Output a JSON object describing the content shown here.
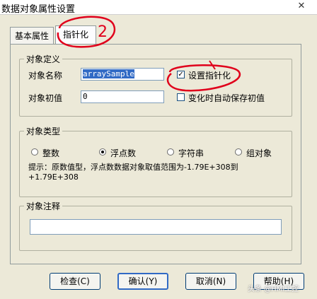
{
  "window": {
    "title": "数据对象属性设置",
    "close_glyph": "✕"
  },
  "tabs": [
    {
      "label": "基本属性"
    },
    {
      "label": "指针化"
    }
  ],
  "object_def": {
    "group_label": "对象定义",
    "name_label": "对象名称",
    "name_value": "arraySample",
    "init_label": "对象初值",
    "init_value": "0",
    "set_pointer_label": "设置指针化",
    "set_pointer_checked": true,
    "auto_save_label": "变化时自动保存初值",
    "auto_save_checked": false
  },
  "object_type": {
    "group_label": "对象类型",
    "options": [
      {
        "label": "整数",
        "selected": false
      },
      {
        "label": "浮点数",
        "selected": true
      },
      {
        "label": "字符串",
        "selected": false
      },
      {
        "label": "组对象",
        "selected": false
      }
    ],
    "hint": "提示：原数值型，浮点数数据对象取值范围为-1.79E+308到+1.79E+308"
  },
  "object_comment": {
    "group_label": "对象注释",
    "value": ""
  },
  "buttons": {
    "check": "检查(C)",
    "confirm": "确认(Y)",
    "cancel": "取消(N)",
    "help": "帮助(H)"
  },
  "annotations": {
    "number": "2",
    "color": "#e0001b"
  },
  "watermark": "头条 @HMI工控"
}
